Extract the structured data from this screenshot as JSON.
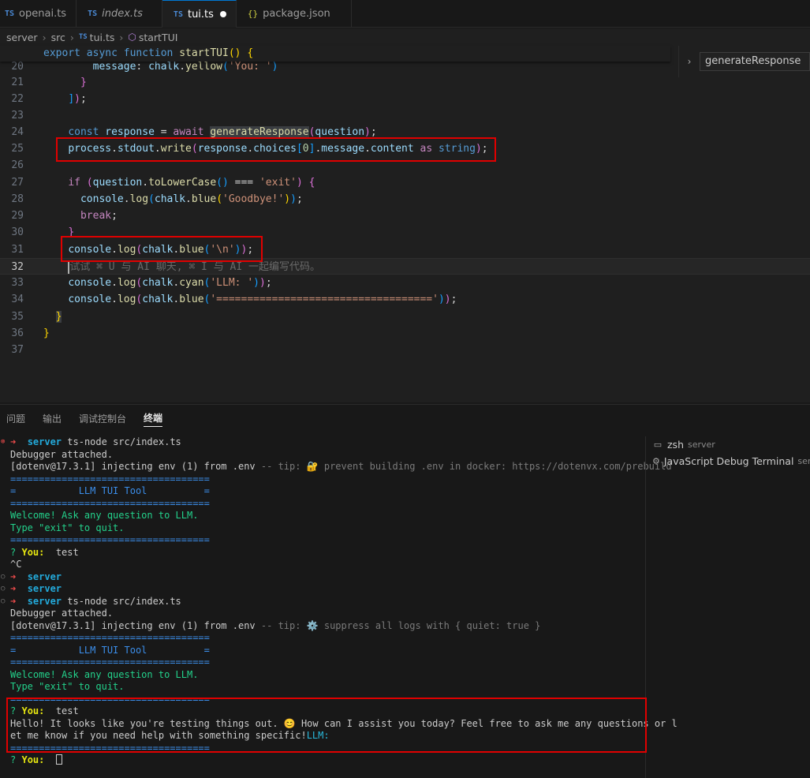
{
  "tabs": [
    {
      "prefix": "TS",
      "label": "openai.ts"
    },
    {
      "prefix": "TS",
      "label": "index.ts"
    },
    {
      "prefix": "TS",
      "label": "tui.ts"
    },
    {
      "prefix": "{}",
      "label": "package.json"
    }
  ],
  "breadcrumb": {
    "server": "server",
    "src": "src",
    "file_prefix": "TS",
    "file": "tui.ts",
    "symbol": "startTUI"
  },
  "peek": {
    "value": "generateResponse"
  },
  "editor": {
    "sticky": "export async function startTUI() {",
    "lines": [
      "20",
      "21",
      "22",
      "23",
      "24",
      "25",
      "26",
      "27",
      "28",
      "29",
      "30",
      "31",
      "32",
      "33",
      "34",
      "35",
      "36",
      "37"
    ],
    "hint": "试试 ⌘ U 与 AI 聊天, ⌘ I 与 AI 一起编写代码。"
  },
  "panel": {
    "tabs": [
      "问题",
      "输出",
      "调试控制台",
      "终端"
    ]
  },
  "terminal": {
    "lines": {
      "l1_dir": "server",
      "l1_cmd": "ts-node src/index.ts",
      "l2": "Debugger attached.",
      "l3a": "[dotenv@17.3.1] injecting env (1) from .env",
      "l3b": " -- tip: 🔐 prevent building .env in docker: https://dotenvx.com/prebuild",
      "sep": "===================================",
      "title": "=           LLM TUI Tool          =",
      "welcome": "Welcome! Ask any question to LLM.",
      "quit": "Type \"exit\" to quit.",
      "q": "?",
      "you": "You:",
      "answer1": "test",
      "ctrlc": "^C",
      "dir_only": "server",
      "l3b2": " -- tip: ⚙️ suppress all logs with { quiet: true }",
      "reply1": "Hello! It looks like you're testing things out. 😊 How can I assist you today? Feel free to ask me any questions or l",
      "reply2": "et me know if you need help with something specific!",
      "llm": "LLM:"
    }
  },
  "term_list": [
    {
      "name": "zsh",
      "sub": "server"
    },
    {
      "name": "JavaScript Debug Terminal",
      "sub": "server"
    }
  ]
}
